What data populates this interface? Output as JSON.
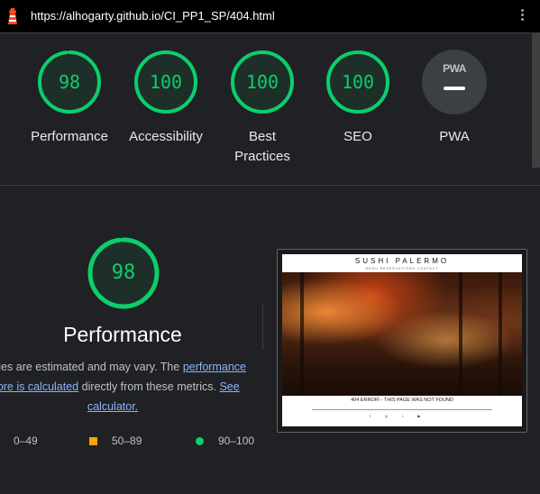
{
  "browser": {
    "url": "https://alhogarty.github.io/CI_PP1_SP/404.html",
    "logo_icon": "lighthouse-icon",
    "menu_icon": "more-vert-icon"
  },
  "colors": {
    "pass": "#0cce6b",
    "average": "#ffa400",
    "fail": "#ff4e42",
    "link": "#8ab4f8"
  },
  "categories": [
    {
      "label": "Performance",
      "score": "98",
      "fraction": 0.98
    },
    {
      "label": "Accessibility",
      "score": "100",
      "fraction": 1.0
    },
    {
      "label": "Best Practices",
      "score": "100",
      "fraction": 1.0
    },
    {
      "label": "SEO",
      "score": "100",
      "fraction": 1.0
    },
    {
      "label": "PWA",
      "badge_text": "PWA",
      "icon": "pwa-badge-icon"
    }
  ],
  "performance": {
    "score": "98",
    "fraction": 0.98,
    "title": "Performance",
    "desc_part1": "Values are estimated and may vary. The ",
    "desc_link1": "performance score is calculated",
    "desc_part2": " directly from these metrics. ",
    "desc_link2": "See calculator.",
    "legend": [
      {
        "range": "0–49",
        "shape": "triangle"
      },
      {
        "range": "50–89",
        "shape": "square"
      },
      {
        "range": "90–100",
        "shape": "circle"
      }
    ]
  },
  "screenshot": {
    "brand": "SUSHI PALERMO",
    "nav": "MENU  RESERVATIONS  CONTACT",
    "message": "404 ERROR! - THIS PAGE WAS NOT FOUND",
    "social_icons": [
      "facebook-icon",
      "instagram-icon",
      "twitter-icon",
      "youtube-icon"
    ]
  }
}
